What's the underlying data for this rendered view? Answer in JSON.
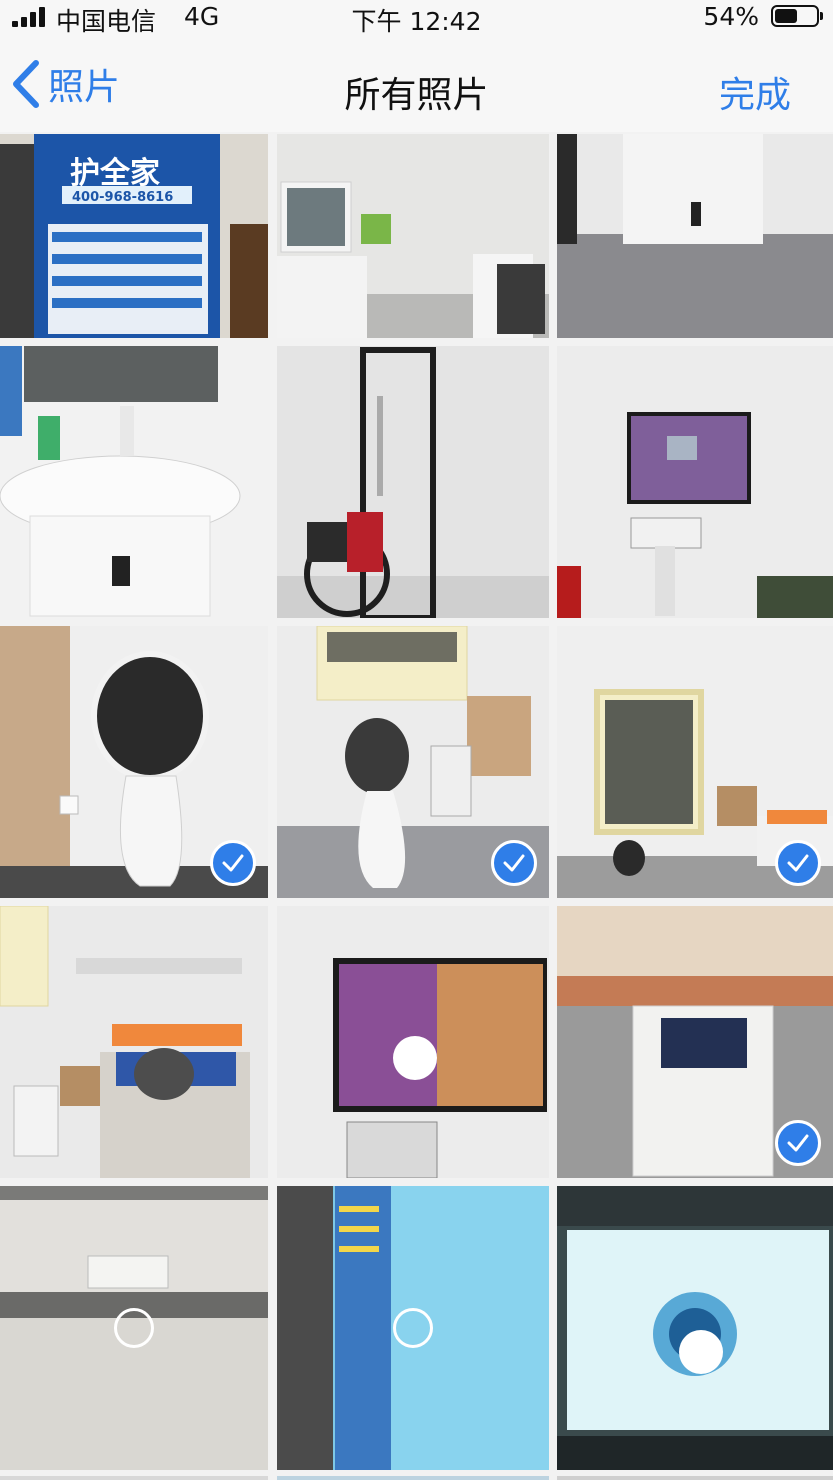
{
  "status_bar": {
    "carrier": "中国电信",
    "network": "4G",
    "time": "下午 12:42",
    "battery": "54%",
    "battery_level": 0.54
  },
  "nav": {
    "back_label": "照片",
    "title": "所有照片",
    "done_label": "完成"
  },
  "photos": [
    {
      "name": "photo-banner",
      "selected": false
    },
    {
      "name": "photo-bathroom-mirror",
      "selected": false
    },
    {
      "name": "photo-sink-unit",
      "selected": false
    },
    {
      "name": "photo-washbasin",
      "selected": false
    },
    {
      "name": "photo-shower-wheelchair",
      "selected": false
    },
    {
      "name": "photo-display-wall",
      "selected": false
    },
    {
      "name": "photo-robot-closeup",
      "selected": true
    },
    {
      "name": "photo-robot-room",
      "selected": true
    },
    {
      "name": "photo-bedroom-window",
      "selected": true
    },
    {
      "name": "photo-bed",
      "selected": false
    },
    {
      "name": "photo-screen-map",
      "selected": false
    },
    {
      "name": "photo-care-machine",
      "selected": true
    },
    {
      "name": "photo-machine-closeup",
      "selected": false
    },
    {
      "name": "photo-blue-screen",
      "selected": false
    },
    {
      "name": "photo-presentation",
      "selected": false
    }
  ],
  "banner_text": {
    "headline": "护全家",
    "phone": "400-968-8616"
  },
  "colors": {
    "accent": "#2f7ee8",
    "nav_bg": "#f7f7f7"
  }
}
